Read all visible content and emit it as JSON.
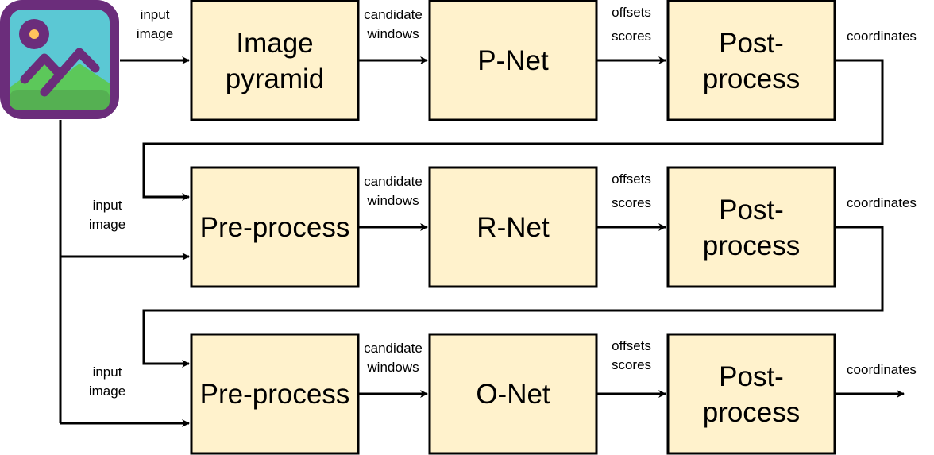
{
  "icon": "image-icon",
  "colors": {
    "box_fill": "#fff2cc",
    "icon_frame": "#6b2d7b",
    "icon_sky": "#5bc8d4",
    "icon_grass": "#5cc85a",
    "icon_sun": "#ffc35c"
  },
  "rows": [
    {
      "boxes": [
        [
          "Image",
          "pyramid"
        ],
        [
          "P-Net"
        ],
        [
          "Post-",
          "process"
        ]
      ],
      "input_label": [
        "input",
        "image"
      ],
      "candidate_label": [
        "candidate",
        "windows"
      ],
      "offsets_label": [
        "offsets",
        "scores"
      ],
      "coordinates_label": "coordinates"
    },
    {
      "boxes": [
        [
          "Pre-process"
        ],
        [
          "R-Net"
        ],
        [
          "Post-",
          "process"
        ]
      ],
      "input_label": [
        "input",
        "image"
      ],
      "candidate_label": [
        "candidate",
        "windows"
      ],
      "offsets_label": [
        "offsets",
        "scores"
      ],
      "coordinates_label": "coordinates"
    },
    {
      "boxes": [
        [
          "Pre-process"
        ],
        [
          "O-Net"
        ],
        [
          "Post-",
          "process"
        ]
      ],
      "input_label": [
        "input",
        "image"
      ],
      "candidate_label": [
        "candidate",
        "windows"
      ],
      "offsets_label": [
        "offsets",
        "scores"
      ],
      "coordinates_label": "coordinates"
    }
  ]
}
